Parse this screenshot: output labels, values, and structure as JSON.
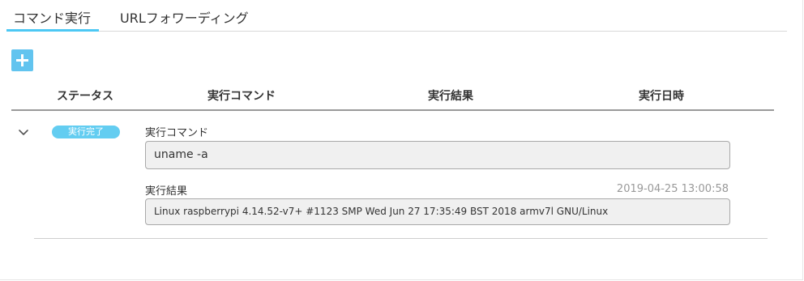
{
  "tabs": [
    {
      "label": "コマンド実行",
      "active": true
    },
    {
      "label": "URLフォワーディング",
      "active": false
    }
  ],
  "accent_color": "#4cc8f4",
  "add_button": {
    "icon": "plus-icon",
    "color": "#62c4ef"
  },
  "table": {
    "headers": [
      "ステータス",
      "実行コマンド",
      "実行結果",
      "実行日時"
    ],
    "rows": [
      {
        "expand_icon": "chevron-down-icon",
        "status": "実行完了",
        "status_color": "#63cdf1",
        "command_label": "実行コマンド",
        "command": "uname -a",
        "result_label": "実行結果",
        "executed_at": "2019-04-25 13:00:58",
        "result": "Linux raspberrypi 4.14.52-v7+ #1123 SMP Wed Jun 27 17:35:49 BST 2018 armv7l GNU/Linux"
      }
    ]
  }
}
